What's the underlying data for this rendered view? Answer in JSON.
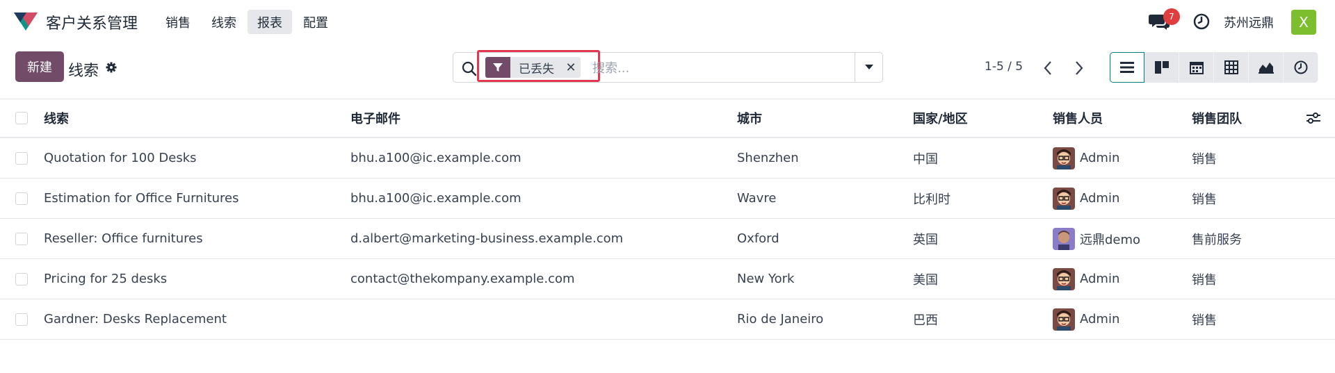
{
  "nav": {
    "app_title": "客户关系管理",
    "menu": [
      "销售",
      "线索",
      "报表",
      "配置"
    ],
    "active_menu": 2,
    "message_count": "7",
    "company": "苏州远鼎",
    "user_initial": "X",
    "brand_color": "#714b67"
  },
  "control": {
    "new_label": "新建",
    "title": "线索",
    "facet_label": "已丢失",
    "search_placeholder": "搜索...",
    "pager": "1-5 / 5"
  },
  "views": [
    "list-view-icon",
    "kanban-view-icon",
    "calendar-view-icon",
    "pivot-view-icon",
    "graph-view-icon",
    "activity-view-icon"
  ],
  "table": {
    "headers": [
      "线索",
      "电子邮件",
      "城市",
      "国家/地区",
      "销售人员",
      "销售团队"
    ],
    "rows": [
      {
        "lead": "Quotation for 100 Desks",
        "email": "bhu.a100@ic.example.com",
        "city": "Shenzhen",
        "country": "中国",
        "salesperson": "Admin",
        "team": "销售",
        "avatar": "admin"
      },
      {
        "lead": "Estimation for Office Furnitures",
        "email": "bhu.a100@ic.example.com",
        "city": "Wavre",
        "country": "比利时",
        "salesperson": "Admin",
        "team": "销售",
        "avatar": "admin"
      },
      {
        "lead": "Reseller: Office furnitures",
        "email": "d.albert@marketing-business.example.com",
        "city": "Oxford",
        "country": "英国",
        "salesperson": "远鼎demo",
        "team": "售前服务",
        "avatar": "demo"
      },
      {
        "lead": "Pricing for 25 desks",
        "email": "contact@thekompany.example.com",
        "city": "New York",
        "country": "美国",
        "salesperson": "Admin",
        "team": "销售",
        "avatar": "admin"
      },
      {
        "lead": "Gardner: Desks Replacement",
        "email": "",
        "city": "Rio de Janeiro",
        "country": "巴西",
        "salesperson": "Admin",
        "team": "销售",
        "avatar": "admin"
      }
    ]
  }
}
